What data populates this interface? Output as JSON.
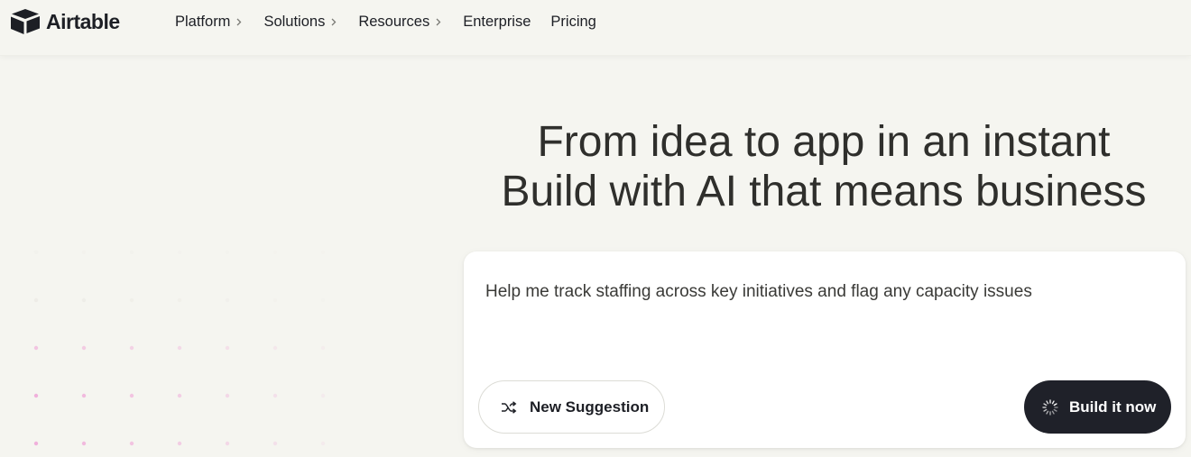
{
  "brand": {
    "name": "Airtable",
    "logo_icon": "airtable-logo-icon",
    "colors": {
      "text": "#1d1f25",
      "background": "#f5f5f0",
      "button_dark": "#1f2129",
      "dot_pink": "#f0a8d8"
    }
  },
  "nav": {
    "items": [
      {
        "label": "Platform",
        "has_chevron": true
      },
      {
        "label": "Solutions",
        "has_chevron": true
      },
      {
        "label": "Resources",
        "has_chevron": true
      },
      {
        "label": "Enterprise",
        "has_chevron": false
      },
      {
        "label": "Pricing",
        "has_chevron": false
      }
    ]
  },
  "hero": {
    "line1": "From idea to app in an instant",
    "line2": "Build with AI that means business"
  },
  "prompt": {
    "text": "Help me track staffing across key initiatives and flag any capacity issues",
    "suggest_label": "New Suggestion",
    "suggest_icon": "shuffle-icon",
    "build_label": "Build it now",
    "build_icon": "spinner-icon"
  }
}
